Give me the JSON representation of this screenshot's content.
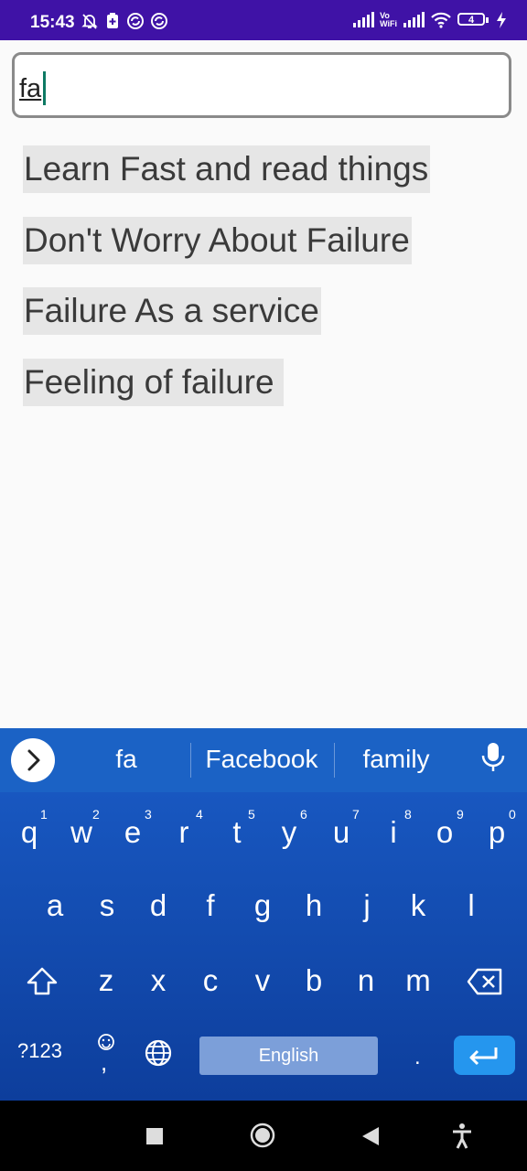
{
  "status_bar": {
    "time": "15:43",
    "battery_level": "4",
    "wifi_label_top": "Vo",
    "wifi_label_bottom": "WiFi"
  },
  "search": {
    "value": "fa"
  },
  "results": [
    {
      "label": "Learn Fast and read things"
    },
    {
      "label": "Don't Worry About Failure"
    },
    {
      "label": "Failure As a service"
    },
    {
      "label": "Feeling of failure"
    }
  ],
  "keyboard": {
    "suggestions": [
      "fa",
      "Facebook",
      "family"
    ],
    "row1": [
      {
        "key": "q",
        "hint": "1"
      },
      {
        "key": "w",
        "hint": "2"
      },
      {
        "key": "e",
        "hint": "3"
      },
      {
        "key": "r",
        "hint": "4"
      },
      {
        "key": "t",
        "hint": "5"
      },
      {
        "key": "y",
        "hint": "6"
      },
      {
        "key": "u",
        "hint": "7"
      },
      {
        "key": "i",
        "hint": "8"
      },
      {
        "key": "o",
        "hint": "9"
      },
      {
        "key": "p",
        "hint": "0"
      }
    ],
    "row2": [
      "a",
      "s",
      "d",
      "f",
      "g",
      "h",
      "j",
      "k",
      "l"
    ],
    "row3": [
      "z",
      "x",
      "c",
      "v",
      "b",
      "n",
      "m"
    ],
    "symbols_label": "?123",
    "comma_label": ",",
    "period_label": ".",
    "space_label": "English"
  },
  "icons": {
    "keyboard_icons": [
      "chevron-right-icon",
      "microphone-icon",
      "shift-icon",
      "backspace-icon",
      "emoji-icon",
      "globe-icon",
      "enter-icon"
    ],
    "nav_icons": [
      "recents-icon",
      "home-icon",
      "back-icon",
      "accessibility-icon"
    ]
  },
  "colors": {
    "status_bar": "#3f12a6",
    "keyboard_top": "#1857c0",
    "keyboard_bottom": "#0d3e9c",
    "suggestion_bar": "#1b62c5",
    "space_key": "#7c9fd9",
    "enter_key": "#2596ee",
    "result_highlight": "#e6e6e6",
    "caret": "#0e7a64"
  }
}
